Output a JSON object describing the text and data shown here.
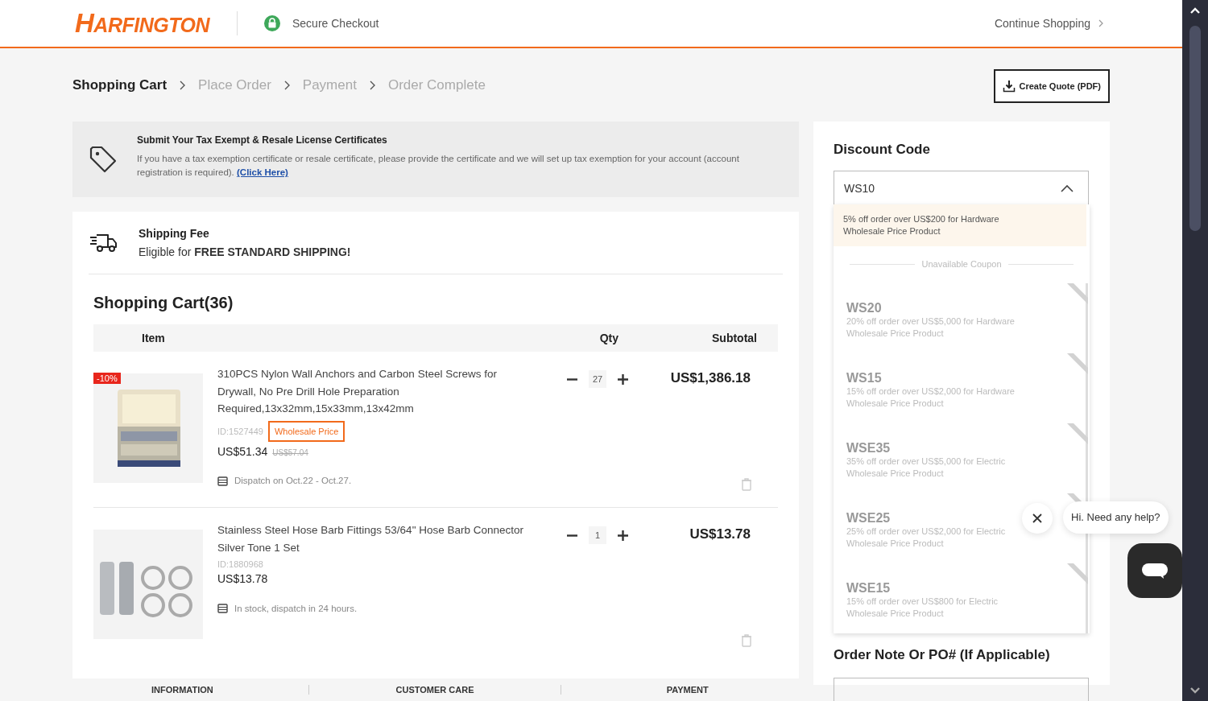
{
  "header": {
    "logo": "HARFINGTON",
    "secure_checkout": "Secure Checkout",
    "continue_shopping": "Continue Shopping"
  },
  "steps": [
    {
      "label": "Shopping Cart",
      "selected": true
    },
    {
      "label": "Place Order",
      "selected": false
    },
    {
      "label": "Payment",
      "selected": false
    },
    {
      "label": "Order Complete",
      "selected": false
    }
  ],
  "quote_button": "Create Quote (PDF)",
  "tax_notice": {
    "title": "Submit Your Tax Exempt & Resale License Certificates",
    "text": "If you have a tax exemption certificate or resale certificate, please provide the certificate and we will set up tax exemption for your account (account registration is required).",
    "link": "(Click Here)"
  },
  "shipping": {
    "title": "Shipping Fee",
    "text": "Eligible for **FREE STANDARD SHIPPING!**"
  },
  "cart": {
    "title": "Shopping Cart(36)",
    "columns": [
      "Item",
      "Qty",
      "Subtotal"
    ],
    "items": [
      {
        "badge": "-10%",
        "name": "310PCS Nylon Wall Anchors and Carbon Steel Screws for Drywall, No Pre Drill Hole Preparation Required,13x32mm,15x33mm,13x42mm",
        "id": "ID:1527449",
        "tag": "Wholesale Price",
        "price": "US$51.34",
        "old_price": "US$57.04",
        "qty": "27",
        "subtotal": "US$1,386.18",
        "dispatch": "Dispatch on Oct.22 - Oct.27.",
        "kind": "case"
      },
      {
        "name": "Stainless Steel Hose Barb Fittings 53/64\" Hose Barb Connector Silver Tone 1 Set",
        "id": "ID:1880968",
        "price": "US$13.78",
        "qty": "1",
        "subtotal": "US$13.78",
        "dispatch": "In stock, dispatch in 24 hours.",
        "kind": "fittings"
      }
    ]
  },
  "discount": {
    "title": "Discount Code",
    "value": "WS10",
    "expanded": true,
    "available": [
      {
        "description": "5% off order over US$200 for Hardware Wholesale Price Product",
        "selected": true
      }
    ],
    "divider": "Unavailable Coupon",
    "unavailable": [
      {
        "code": "WS20",
        "description": "20% off order over US$5,000 for Hardware Wholesale Price Product"
      },
      {
        "code": "WS15",
        "description": "15% off order over US$2,000 for Hardware Wholesale Price Product"
      },
      {
        "code": "WSE35",
        "description": "35% off order over US$5,000 for Electric Wholesale Price Product"
      },
      {
        "code": "WSE25",
        "description": "25% off order over US$2,000 for Electric Wholesale Price Product"
      },
      {
        "code": "WSE15",
        "description": "15% off order over US$800 for Electric Wholesale Price Product"
      }
    ]
  },
  "order_note": {
    "title": "Order Note Or PO# (If Applicable)"
  },
  "footer": [
    "INFORMATION",
    "CUSTOMER CARE",
    "PAYMENT"
  ],
  "chat": {
    "greeting": "Hi. Need any help?"
  }
}
